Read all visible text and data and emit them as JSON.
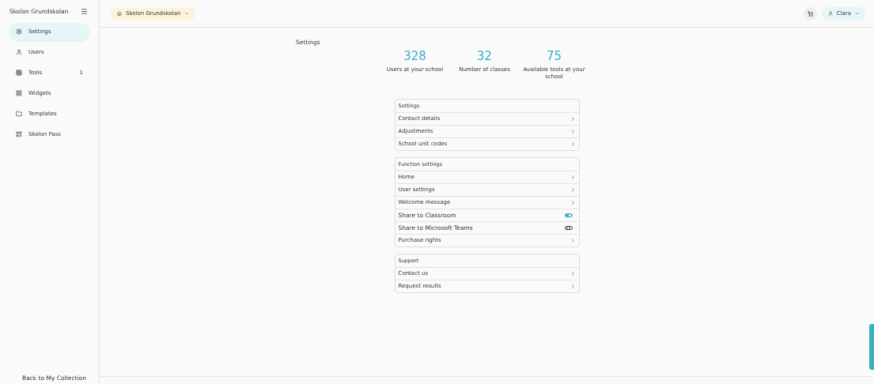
{
  "sidebar": {
    "title": "Skolon Grundskolan",
    "items": [
      {
        "label": "Settings",
        "selected": true
      },
      {
        "label": "Users",
        "selected": false
      },
      {
        "label": "Tools",
        "selected": false,
        "count": "1"
      },
      {
        "label": "Widgets",
        "selected": false
      },
      {
        "label": "Templates",
        "selected": false
      },
      {
        "label": "Skolon Pass",
        "selected": false
      }
    ],
    "back_link": "Back to My Collection"
  },
  "header": {
    "school_selector": "Skolon Grundskolan",
    "user_menu": "Clara"
  },
  "page_title": "Settings",
  "stats": [
    {
      "value": "328",
      "label": "Users at your school"
    },
    {
      "value": "32",
      "label": "Number of classes"
    },
    {
      "value": "75",
      "label": "Available tools at your school"
    }
  ],
  "sections": [
    {
      "title": "Settings",
      "rows": [
        {
          "kind": "link",
          "label": "Contact details"
        },
        {
          "kind": "link",
          "label": "Adjustments"
        },
        {
          "kind": "link",
          "label": "School unit codes"
        }
      ]
    },
    {
      "title": "Function settings",
      "rows": [
        {
          "kind": "link",
          "label": "Home"
        },
        {
          "kind": "link",
          "label": "User settings"
        },
        {
          "kind": "link",
          "label": "Welcome message"
        },
        {
          "kind": "toggle",
          "label": "Share to Classroom",
          "on": true
        },
        {
          "kind": "toggle",
          "label": "Share to Microsoft Teams",
          "on": false
        },
        {
          "kind": "link",
          "label": "Purchase rights"
        }
      ]
    },
    {
      "title": "Support",
      "rows": [
        {
          "kind": "link",
          "label": "Contact us"
        },
        {
          "kind": "link",
          "label": "Request results"
        }
      ]
    }
  ]
}
